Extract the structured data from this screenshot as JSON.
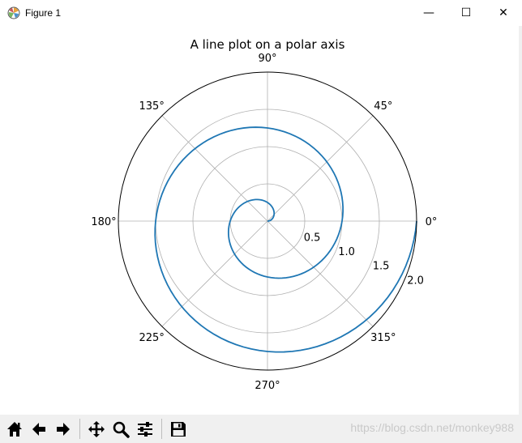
{
  "window": {
    "title": "Figure 1",
    "minimize_glyph": "—",
    "maximize_glyph": "☐",
    "close_glyph": "✕"
  },
  "chart_data": {
    "type": "line",
    "projection": "polar",
    "title": "A line plot on a polar axis",
    "r_max": 2,
    "r_ticks": [
      0.5,
      1.0,
      1.5,
      2.0
    ],
    "r_tick_labels": [
      "0.5",
      "1.0",
      "1.5",
      "2.0"
    ],
    "theta_ticks_deg": [
      0,
      45,
      90,
      135,
      180,
      225,
      270,
      315
    ],
    "theta_tick_labels": [
      "0°",
      "45°",
      "90°",
      "135°",
      "180°",
      "225°",
      "270°",
      "315°"
    ],
    "grid": true,
    "series": [
      {
        "r": {
          "start": 0,
          "stop": 2,
          "step": 0.01
        },
        "theta_formula": "2*pi*r",
        "color": "#1f77b4"
      }
    ]
  },
  "toolbar": {
    "icons": [
      "home-icon",
      "back-icon",
      "forward-icon",
      "pan-icon",
      "zoom-icon",
      "configure-subplots-icon",
      "save-icon"
    ]
  },
  "watermark": "https://blog.csdn.net/monkey988"
}
